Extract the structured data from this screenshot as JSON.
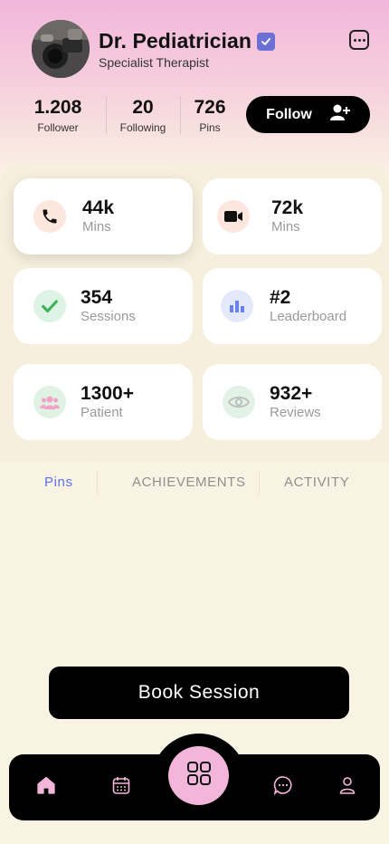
{
  "profile": {
    "name": "Dr. Pediatrician",
    "subtitle": "Specialist Therapist"
  },
  "stats": [
    {
      "value": "1.208",
      "label": "Follower"
    },
    {
      "value": "20",
      "label": "Following"
    },
    {
      "value": "726",
      "label": "Pins"
    }
  ],
  "follow_label": "Follow",
  "cards": [
    {
      "value": "44k",
      "caption": "Mins",
      "icon": "phone-icon"
    },
    {
      "value": "72k",
      "caption": "Mins",
      "icon": "video-icon"
    },
    {
      "value": "354",
      "caption": "Sessions",
      "icon": "check-icon"
    },
    {
      "value": "#2",
      "caption": "Leaderboard",
      "icon": "bar-chart-icon"
    },
    {
      "value": "1300+",
      "caption": "Patient",
      "icon": "users-icon"
    },
    {
      "value": "932+",
      "caption": "Reviews",
      "icon": "eye-icon"
    }
  ],
  "tabs": [
    {
      "label": "Pins"
    },
    {
      "label": "ACHIEVEMENTS"
    },
    {
      "label": "ACTIVITY"
    }
  ],
  "book_label": "Book Session",
  "colors": {
    "accent_pink": "#f2b6da",
    "tab_active": "#5b6ef0",
    "verified": "#6c6fd3",
    "background": "#f9f3e4"
  },
  "nav": [
    "home-icon",
    "calendar-icon",
    "grid-icon",
    "chat-icon",
    "user-icon"
  ]
}
